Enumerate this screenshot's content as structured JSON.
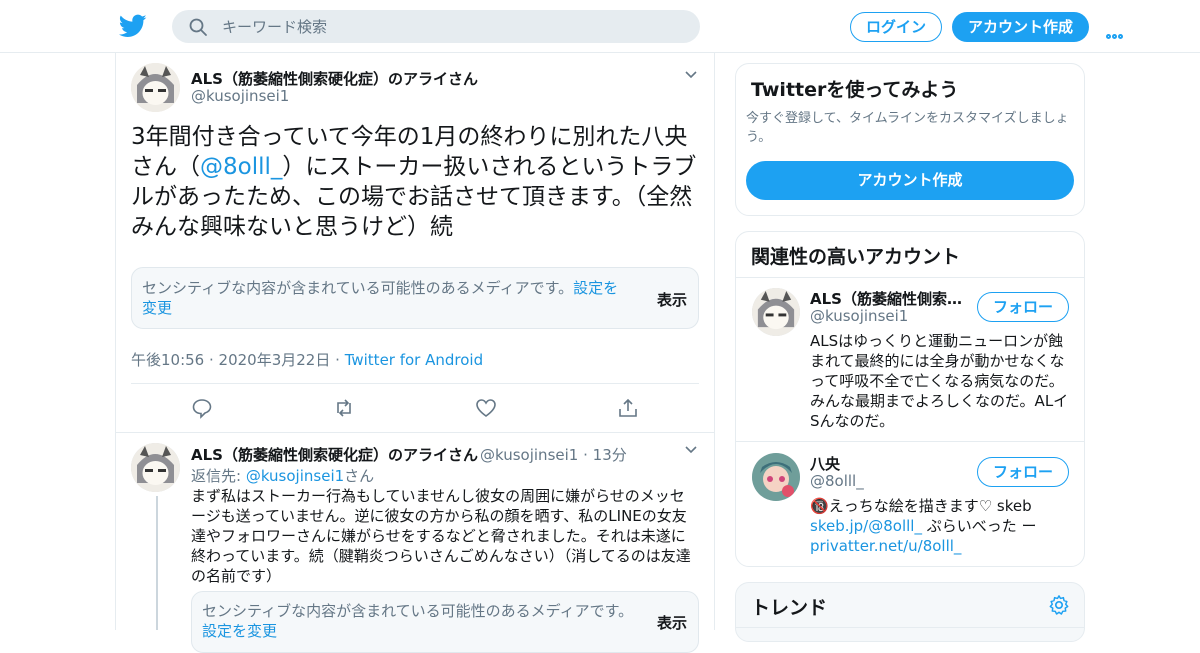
{
  "header": {
    "search_placeholder": "キーワード検索",
    "login_label": "ログイン",
    "signup_label": "アカウント作成"
  },
  "tweet": {
    "author_name": "ALS（筋萎縮性側索硬化症）のアライさん",
    "author_handle": "@kusojinsei1",
    "text_part1": "3年間付き合っていて今年の1月の終わりに別れた八央さん（",
    "text_mention": "@8olll_",
    "text_part2": "）にストーカー扱いされるというトラブルがあったため、この場でお話させて頂きます。（全然みんな興味ないと思うけど）続",
    "sensitive_msg": "センシティブな内容が含まれている可能性のあるメディアです。",
    "sensitive_link": "設定を変更",
    "show_label": "表示",
    "timestamp": "午後10:56 · 2020年3月22日",
    "separator": "·",
    "source": "Twitter for Android"
  },
  "reply": {
    "author_name": "ALS（筋萎縮性側索硬化症）のアライさん",
    "author_handle": "@kusojinsei1",
    "time": "· 13分",
    "reply_prefix": "返信先: ",
    "reply_to": "@kusojinsei1",
    "reply_suffix": "さん",
    "text": "まず私はストーカー行為もしていませんし彼女の周囲に嫌がらせのメッセージも送っていません。逆に彼女の方から私の顔を晒す、私のLINEの女友達やフォロワーさんに嫌がらせをするなどと脅されました。それは未遂に終わっています。続（腱鞘炎つらいさんごめんなさい）（消してるのは友達の名前です）",
    "sensitive_msg": "センシティブな内容が含まれている可能性のあるメディアです。",
    "sensitive_link": "設定を変更",
    "show_label": "表示"
  },
  "signup_card": {
    "title": "Twitterを使ってみよう",
    "subtitle": "今すぐ登録して、タイムラインをカスタマイズしましょう。",
    "button": "アカウント作成"
  },
  "related": {
    "title": "関連性の高いアカウント",
    "follow_label": "フォロー",
    "accounts": [
      {
        "name": "ALS（筋萎縮性側索…",
        "handle": "@kusojinsei1",
        "bio": "ALSはゆっくりと運動ニューロンが蝕まれて最終的には全身が動かせなくなって呼吸不全で亡くなる病気なのだ。みんな最期までよろしくなのだ。ALイSんなのだ。"
      },
      {
        "name": "八央",
        "handle": "@8olll_",
        "bio_icon": "🔞",
        "bio_part1": "えっちな絵を描きます♡ skeb",
        "bio_link1": "skeb.jp/@8olll_",
        "bio_part2": " ぷらいべった ー",
        "bio_link2": "privatter.net/u/8olll_"
      }
    ]
  },
  "trends": {
    "title": "トレンド"
  },
  "colors": {
    "brand": "#1da1f2",
    "link": "#1b95e0",
    "muted": "#657786",
    "border": "#e6ecf0"
  }
}
